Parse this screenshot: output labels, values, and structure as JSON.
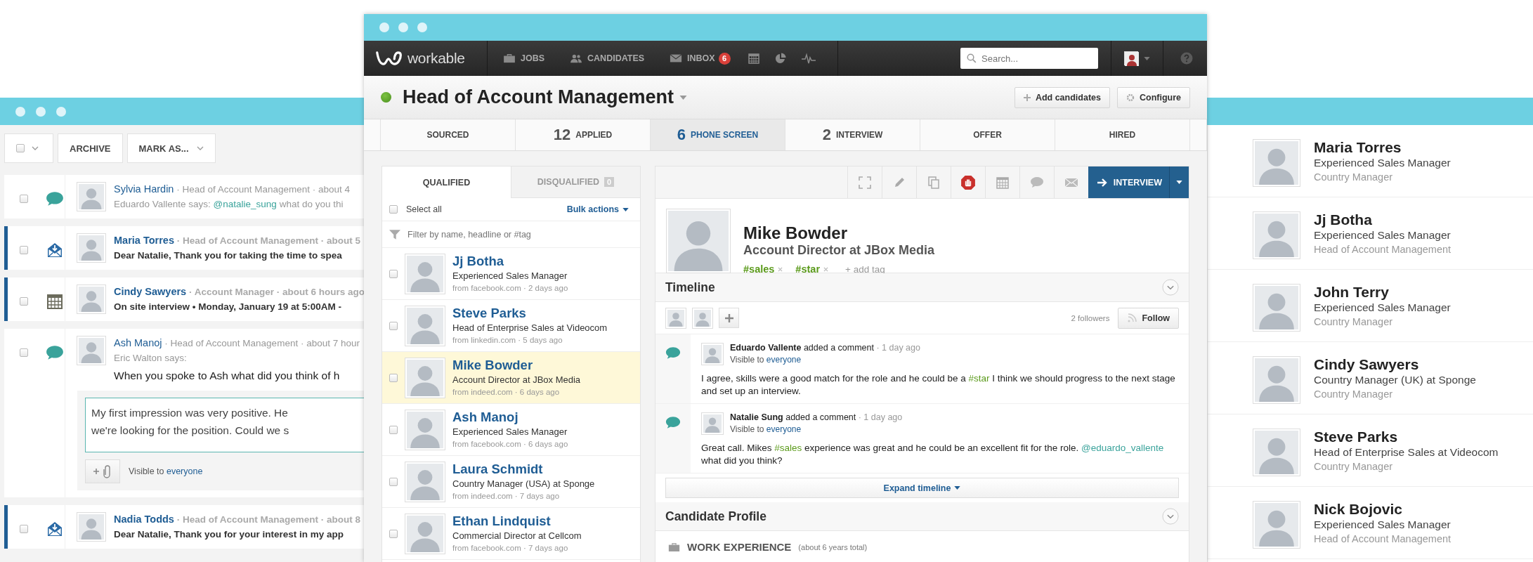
{
  "back_window": {
    "toolbar": {
      "select_checked": false,
      "archive_button": "ARCHIVE",
      "mark_as_button": "MARK AS..."
    },
    "activity": [
      {
        "kind": "comment",
        "unread": false,
        "checked": false,
        "name": "Sylvia Hardin",
        "meta": "· Head of Account Management · about 4",
        "summary": [
          {
            "kind": "plain",
            "text": "Eduardo Vallente says: "
          },
          {
            "kind": "mention",
            "text": "@natalie_sung"
          },
          {
            "kind": "plain",
            "text": " what do you thi"
          }
        ]
      },
      {
        "kind": "email",
        "unread": true,
        "checked": false,
        "name": "Maria Torres",
        "meta": "· Head of Account Management · about 5",
        "summary": [
          {
            "kind": "plain",
            "text": "Dear Natalie, Thank you for taking the time to spea"
          }
        ]
      },
      {
        "kind": "calendar",
        "unread": true,
        "checked": false,
        "name": "Cindy Sawyers",
        "meta": "· Account Manager · about 6 hours ago",
        "summary": [
          {
            "kind": "plain",
            "text": "On site interview • Monday, January 19 at 5:00AM -"
          }
        ]
      },
      {
        "kind": "comment",
        "unread": false,
        "checked": false,
        "name": "Ash Manoj",
        "meta": "· Head of Account Management · about 7 hour",
        "summary": [
          {
            "kind": "plain",
            "text": "Eric Walton says:"
          }
        ],
        "question": "When you spoke to Ash what did you think of h",
        "reply": {
          "lines": [
            "My first impression was very positive. He",
            "we're looking for the position. Could we s"
          ],
          "visibility": "Visible to",
          "audience": "everyone"
        }
      },
      {
        "kind": "email",
        "unread": true,
        "checked": false,
        "name": "Nadia Todds",
        "meta": "· Head of Account Management · about 8",
        "summary": [
          {
            "kind": "plain",
            "text": "Dear Natalie, Thank you for your interest in my app"
          }
        ]
      }
    ],
    "people": [
      {
        "name": "Maria Torres",
        "headline": "Experienced Sales Manager",
        "job": "Country Manager"
      },
      {
        "name": "Jj Botha",
        "headline": "Experienced Sales Manager",
        "job": "Head of Account Management"
      },
      {
        "name": "John Terry",
        "headline": "Experienced Sales Manager",
        "job": "Country Manager"
      },
      {
        "name": "Cindy Sawyers",
        "headline": "Country Manager (UK) at Sponge",
        "job": "Country Manager"
      },
      {
        "name": "Steve Parks",
        "headline": "Head of Enterprise Sales at Videocom",
        "job": "Country Manager"
      },
      {
        "name": "Nick Bojovic",
        "headline": "Experienced Sales Manager",
        "job": "Head of Account Management"
      }
    ]
  },
  "window": {
    "logo": "workable",
    "nav": [
      {
        "kind": "jobs",
        "label": "JOBS"
      },
      {
        "kind": "candidates",
        "label": "CANDIDATES"
      },
      {
        "kind": "inbox",
        "label": "INBOX",
        "badge": "6"
      }
    ],
    "search": {
      "placeholder": "Search..."
    },
    "job": {
      "title": "Head of Account Management",
      "buttons": [
        "Add candidates",
        "Configure"
      ]
    },
    "stages": [
      {
        "label": "SOURCED",
        "selected": false
      },
      {
        "count": "12",
        "label": "APPLIED",
        "selected": false
      },
      {
        "count": "6",
        "label": "PHONE SCREEN",
        "selected": true
      },
      {
        "count": "2",
        "label": "INTERVIEW",
        "selected": false
      },
      {
        "label": "OFFER",
        "selected": false
      },
      {
        "label": "HIRED",
        "selected": false
      }
    ],
    "list_tabs": [
      {
        "label": "QUALIFIED",
        "selected": true
      },
      {
        "label": "DISQUALIFIED",
        "count": "0",
        "selected": false
      }
    ],
    "select_all": {
      "label": "Select all",
      "checked": false
    },
    "bulk_actions": "Bulk actions",
    "filter": {
      "placeholder": "Filter by name, headline or #tag"
    },
    "candidates": [
      {
        "name": "Jj Botha",
        "headline": "Experienced Sales Manager",
        "meta": "from facebook.com · 2 days ago",
        "checked": false,
        "selected": false
      },
      {
        "name": "Steve Parks",
        "headline": "Head of Enterprise Sales at Videocom",
        "meta": "from linkedin.com · 5 days ago",
        "checked": false,
        "selected": false
      },
      {
        "name": "Mike Bowder",
        "headline": "Account Director at JBox Media",
        "meta": "from indeed.com · 6 days ago",
        "checked": false,
        "selected": true
      },
      {
        "name": "Ash Manoj",
        "headline": "Experienced Sales Manager",
        "meta": "from facebook.com · 6 days ago",
        "checked": false,
        "selected": false
      },
      {
        "name": "Laura Schmidt",
        "headline": "Country Manager (USA) at Sponge",
        "meta": "from indeed.com · 7 days ago",
        "checked": false,
        "selected": false
      },
      {
        "name": "Ethan Lindquist",
        "headline": "Commercial Director at Cellcom",
        "meta": "from facebook.com · 7 days ago",
        "checked": false,
        "selected": false
      }
    ],
    "move_button": "INTERVIEW",
    "profile": {
      "name": "Mike Bowder",
      "headline": "Account Director at JBox Media",
      "tags": [
        "#sales",
        "#star"
      ],
      "add_tag": "+ add tag"
    },
    "timeline": {
      "title": "Timeline",
      "followers": "2 followers",
      "follow_button": "Follow",
      "comments": [
        {
          "author": "Eduardo Vallente",
          "action": "added a comment",
          "time": "· 1 day ago",
          "visibility": "Visible to",
          "audience": "everyone",
          "body": [
            {
              "kind": "plain",
              "text": "I agree, skills were a good match for the role and he could be a "
            },
            {
              "kind": "tag",
              "text": "#star"
            },
            {
              "kind": "plain",
              "text": " I think we should progress to the next stage and set up an interview."
            }
          ]
        },
        {
          "author": "Natalie Sung",
          "action": "added a comment",
          "time": "· 1 day ago",
          "visibility": "Visible to",
          "audience": "everyone",
          "body": [
            {
              "kind": "plain",
              "text": "Great call. Mikes "
            },
            {
              "kind": "tag",
              "text": "#sales"
            },
            {
              "kind": "plain",
              "text": " experience was great and he could be an excellent fit for the role. "
            },
            {
              "kind": "mention",
              "text": "@eduardo_vallente"
            },
            {
              "kind": "plain",
              "text": " what did you think?"
            }
          ]
        }
      ],
      "expand_button": "Expand timeline"
    },
    "profile_section": {
      "title": "Candidate Profile",
      "heading": "WORK EXPERIENCE",
      "note": "(about 6 years total)"
    }
  }
}
